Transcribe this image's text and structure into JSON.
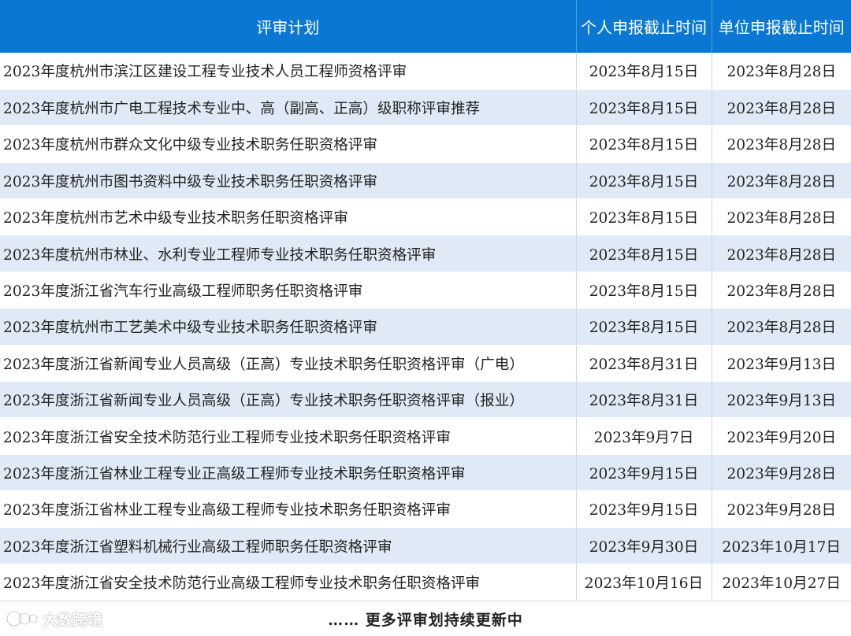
{
  "table": {
    "headers": {
      "plan": "评审计划",
      "personal_deadline": "个人申报截止时间",
      "unit_deadline": "单位申报截止时间"
    },
    "rows": [
      {
        "plan": "2023年度杭州市滨江区建设工程专业技术人员工程师资格评审",
        "personal": "2023年8月15日",
        "unit": "2023年8月28日"
      },
      {
        "plan": "2023年度杭州市广电工程技术专业中、高（副高、正高）级职称评审推荐",
        "personal": "2023年8月15日",
        "unit": "2023年8月28日"
      },
      {
        "plan": "2023年度杭州市群众文化中级专业技术职务任职资格评审",
        "personal": "2023年8月15日",
        "unit": "2023年8月28日"
      },
      {
        "plan": "2023年度杭州市图书资料中级专业技术职务任职资格评审",
        "personal": "2023年8月15日",
        "unit": "2023年8月28日"
      },
      {
        "plan": "2023年度杭州市艺术中级专业技术职务任职资格评审",
        "personal": "2023年8月15日",
        "unit": "2023年8月28日"
      },
      {
        "plan": "2023年度杭州市林业、水利专业工程师专业技术职务任职资格评审",
        "personal": "2023年8月15日",
        "unit": "2023年8月28日"
      },
      {
        "plan": "2023年度浙江省汽车行业高级工程师职务任职资格评审",
        "personal": "2023年8月15日",
        "unit": "2023年8月28日"
      },
      {
        "plan": "2023年度杭州市工艺美术中级专业技术职务任职资格评审",
        "personal": "2023年8月15日",
        "unit": "2023年8月28日"
      },
      {
        "plan": "2023年度浙江省新闻专业人员高级（正高）专业技术职务任职资格评审（广电）",
        "personal": "2023年8月31日",
        "unit": "2023年9月13日"
      },
      {
        "plan": "2023年度浙江省新闻专业人员高级（正高）专业技术职务任职资格评审（报业）",
        "personal": "2023年8月31日",
        "unit": "2023年9月13日"
      },
      {
        "plan": "2023年度浙江省安全技术防范行业工程师专业技术职务任职资格评审",
        "personal": "2023年9月7日",
        "unit": "2023年9月20日"
      },
      {
        "plan": "2023年度浙江省林业工程专业正高级工程师专业技术职务任职资格评审",
        "personal": "2023年9月15日",
        "unit": "2023年9月28日"
      },
      {
        "plan": "2023年度浙江省林业工程专业高级工程师专业技术职务任职资格评审",
        "personal": "2023年9月15日",
        "unit": "2023年9月28日"
      },
      {
        "plan": "2023年度浙江省塑料机械行业高级工程师职务任职资格评审",
        "personal": "2023年9月30日",
        "unit": "2023年10月17日"
      },
      {
        "plan": "2023年度浙江省安全技术防范行业高级工程师专业技术职务任职资格评审",
        "personal": "2023年10月16日",
        "unit": "2023年10月27日"
      }
    ]
  },
  "footer": {
    "more_text": "……  更多评审划持续更新中"
  },
  "watermark": {
    "text": "大数跨境",
    "icon": "watermark-logo-icon"
  },
  "colors": {
    "header_bg": "#0a78d2",
    "row_alt_bg": "#dfeaf6"
  }
}
